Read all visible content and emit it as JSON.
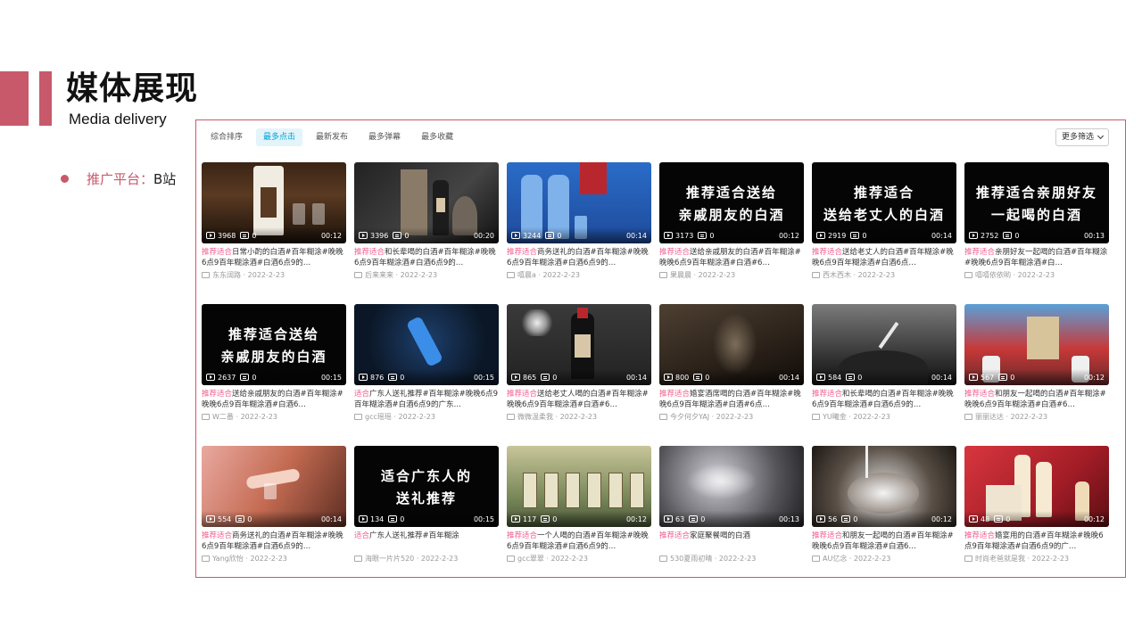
{
  "slide": {
    "title": "媒体展现",
    "subtitle": "Media delivery",
    "bullet_label": "推广平台：",
    "bullet_value": "B站",
    "accent": "#c8596b"
  },
  "toolbar": {
    "tabs": [
      {
        "label": "综合排序",
        "active": false
      },
      {
        "label": "最多点击",
        "active": true
      },
      {
        "label": "最新发布",
        "active": false
      },
      {
        "label": "最多弹幕",
        "active": false
      },
      {
        "label": "最多收藏",
        "active": false
      }
    ],
    "filter_label": "更多筛选"
  },
  "videos": [
    {
      "views": "3968",
      "danmaku": "0",
      "duration": "00:12",
      "title_hl": "推荐适合",
      "title_rest": "日常小酌的白酒#百年糊涂#晚晚6点9百年糊涂酒#白酒6点9的…",
      "uploader": "东东阔路",
      "date": "2022-2-23"
    },
    {
      "views": "3396",
      "danmaku": "0",
      "duration": "00:20",
      "title_hl": "推荐适合",
      "title_rest": "和长辈喝的白酒#百年糊涂#晚晚6点9百年糊涂酒#白酒6点9的…",
      "uploader": "后来来来",
      "date": "2022-2-23"
    },
    {
      "views": "3244",
      "danmaku": "0",
      "duration": "00:14",
      "title_hl": "推荐适合",
      "title_rest": "商务送礼的白酒#百年糊涂#晚晚6点9百年糊涂酒#白酒6点9的…",
      "uploader": "嘻晨a",
      "date": "2022-2-23"
    },
    {
      "views": "3173",
      "danmaku": "0",
      "duration": "00:12",
      "title_hl": "推荐适合",
      "title_rest": "送给亲戚朋友的白酒#百年糊涂#晚晚6点9百年糊涂酒#白酒#6…",
      "uploader": "果晨晨",
      "date": "2022-2-23",
      "thumb_text": "推荐适合送给\n亲戚朋友的白酒"
    },
    {
      "views": "2919",
      "danmaku": "0",
      "duration": "00:14",
      "title_hl": "推荐适合",
      "title_rest": "送给老丈人的白酒#百年糊涂#晚晚6点9百年糊涂酒#白酒6点…",
      "uploader": "西木西木",
      "date": "2022-2-23",
      "thumb_text": "推荐适合\n送给老丈人的白酒"
    },
    {
      "views": "2752",
      "danmaku": "0",
      "duration": "00:13",
      "title_hl": "推荐适合",
      "title_rest": "亲朋好友一起喝的白酒#百年糊涂#晚晚6点9百年糊涂酒#白…",
      "uploader": "嘻嘻依依哟",
      "date": "2022-2-23",
      "thumb_text": "推荐适合亲朋好友\n一起喝的白酒"
    },
    {
      "views": "2637",
      "danmaku": "0",
      "duration": "00:15",
      "title_hl": "推荐适合",
      "title_rest": "送给亲戚朋友的白酒#百年糊涂#晚晚6点9百年糊涂酒#白酒6…",
      "uploader": "W二番",
      "date": "2022-2-23",
      "thumb_text": "推荐适合送给\n亲戚朋友的白酒"
    },
    {
      "views": "876",
      "danmaku": "0",
      "duration": "00:15",
      "title_hl": "适合",
      "title_rest": "广东人送礼推荐#百年糊涂#晚晚6点9百年糊涂酒#白酒6点9的广东…",
      "uploader": "gcc瑶瑶",
      "date": "2022-2-23"
    },
    {
      "views": "865",
      "danmaku": "0",
      "duration": "00:14",
      "title_hl": "推荐适合",
      "title_rest": "送给老丈人喝的白酒#百年糊涂#晚晚6点9百年糊涂酒#白酒#6…",
      "uploader": "微微温柔我",
      "date": "2022-2-23"
    },
    {
      "views": "800",
      "danmaku": "0",
      "duration": "00:14",
      "title_hl": "推荐适合",
      "title_rest": "婚宴酒席喝的白酒#百年糊涂#晚晚6点9百年糊涂酒#白酒#6点…",
      "uploader": "今夕何夕YAJ",
      "date": "2022-2-23"
    },
    {
      "views": "584",
      "danmaku": "0",
      "duration": "00:14",
      "title_hl": "推荐适合",
      "title_rest": "和长辈喝的白酒#百年糊涂#晚晚6点9百年糊涂酒#白酒6点9的…",
      "uploader": "YU曦金",
      "date": "2022-2-23"
    },
    {
      "views": "567",
      "danmaku": "0",
      "duration": "00:12",
      "title_hl": "推荐适合",
      "title_rest": "和朋友一起喝的白酒#百年糊涂#晚晚6点9百年糊涂酒#白酒#6…",
      "uploader": "丽丽达达",
      "date": "2022-2-23"
    },
    {
      "views": "554",
      "danmaku": "0",
      "duration": "00:14",
      "title_hl": "推荐适合",
      "title_rest": "商务送礼的白酒#百年糊涂#晚晚6点9百年糊涂酒#白酒6点9的…",
      "uploader": "Yang欣怡",
      "date": "2022-2-23"
    },
    {
      "views": "134",
      "danmaku": "0",
      "duration": "00:15",
      "title_hl": "适合",
      "title_rest": "广东人送礼推荐#百年糊涂",
      "uploader": "海眼一片片520",
      "date": "2022-2-23",
      "thumb_text": "适合广东人的\n送礼推荐"
    },
    {
      "views": "117",
      "danmaku": "0",
      "duration": "00:12",
      "title_hl": "推荐适合",
      "title_rest": "一个人喝的白酒#百年糊涂#晚晚6点9百年糊涂酒#白酒6点9的…",
      "uploader": "gcc翠翠",
      "date": "2022-2-23"
    },
    {
      "views": "63",
      "danmaku": "0",
      "duration": "00:13",
      "title_hl": "推荐适合",
      "title_rest": "家庭聚餐喝的白酒",
      "uploader": "530夏雨初晴",
      "date": "2022-2-23"
    },
    {
      "views": "56",
      "danmaku": "0",
      "duration": "00:12",
      "title_hl": "推荐适合",
      "title_rest": "和朋友一起喝的白酒#百年糊涂#晚晚6点9百年糊涂酒#白酒6…",
      "uploader": "AU亿念",
      "date": "2022-2-23"
    },
    {
      "views": "48",
      "danmaku": "0",
      "duration": "00:12",
      "title_hl": "推荐适合",
      "title_rest": "婚宴用的白酒#百年糊涂#晚晚6点9百年糊涂酒#白酒6点9的广…",
      "uploader": "时尚老爸就是我",
      "date": "2022-2-23"
    }
  ]
}
